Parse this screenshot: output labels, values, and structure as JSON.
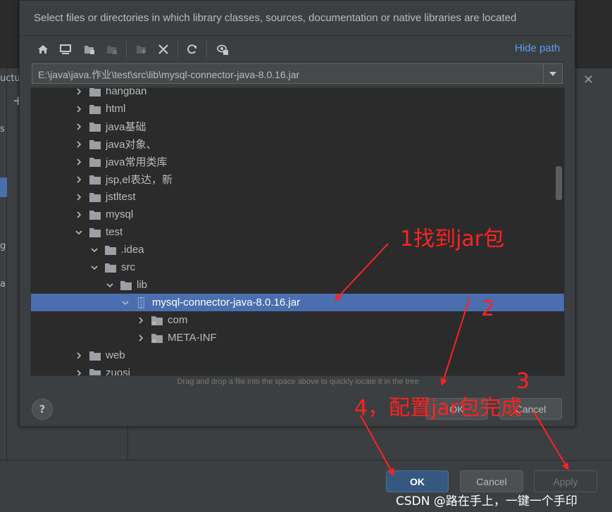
{
  "chooser": {
    "description": "Select files or directories in which library classes, sources, documentation or native libraries are located",
    "hide_path": "Hide path",
    "path": "E:\\java\\java.作业\\test\\src\\lib\\mysql-connector-java-8.0.16.jar",
    "hint": "Drag and drop a file into the space above to quickly locate it in the tree",
    "ok": "OK",
    "cancel": "Cancel",
    "help": "?",
    "toolbar_icons": [
      "home-icon",
      "desktop-icon",
      "project-icon",
      "module-icon",
      "new-folder-icon",
      "delete-icon",
      "refresh-icon",
      "show-hidden-icon"
    ],
    "tree": [
      {
        "label": "hangban",
        "depth": 0,
        "expanded": false,
        "type": "folder"
      },
      {
        "label": "html",
        "depth": 0,
        "expanded": false,
        "type": "folder"
      },
      {
        "label": "java基础",
        "depth": 0,
        "expanded": false,
        "type": "folder"
      },
      {
        "label": "java对象、",
        "depth": 0,
        "expanded": false,
        "type": "folder"
      },
      {
        "label": "java常用类库",
        "depth": 0,
        "expanded": false,
        "type": "folder"
      },
      {
        "label": "jsp,el表达，新",
        "depth": 0,
        "expanded": false,
        "type": "folder"
      },
      {
        "label": "jstltest",
        "depth": 0,
        "expanded": false,
        "type": "folder"
      },
      {
        "label": "mysql",
        "depth": 0,
        "expanded": false,
        "type": "folder"
      },
      {
        "label": "test",
        "depth": 0,
        "expanded": true,
        "type": "folder"
      },
      {
        "label": ".idea",
        "depth": 1,
        "expanded": true,
        "type": "folder"
      },
      {
        "label": "src",
        "depth": 1,
        "expanded": true,
        "type": "folder"
      },
      {
        "label": "lib",
        "depth": 2,
        "expanded": true,
        "type": "folder"
      },
      {
        "label": "mysql-connector-java-8.0.16.jar",
        "depth": 3,
        "expanded": true,
        "type": "jar",
        "selected": true
      },
      {
        "label": "com",
        "depth": 4,
        "expanded": false,
        "type": "package"
      },
      {
        "label": "META-INF",
        "depth": 4,
        "expanded": false,
        "type": "package"
      },
      {
        "label": "web",
        "depth": 0,
        "expanded": false,
        "type": "folder"
      },
      {
        "label": "zuosi",
        "depth": 0,
        "expanded": false,
        "type": "folder"
      }
    ]
  },
  "background": {
    "left_fragments": [
      "uctu",
      "s",
      "g",
      "a"
    ],
    "ok": "OK",
    "cancel": "Cancel",
    "apply": "Apply"
  },
  "annotations": {
    "step1": "1找到jar包",
    "step2": "2",
    "step3": "3",
    "step4": "4，配置jar包完成"
  },
  "watermark": "CSDN @路在手上，一键一个手印",
  "colors": {
    "accent": "#4b6eaf",
    "link": "#589df6",
    "annotation": "#ff2222",
    "primary_button": "#365880"
  }
}
